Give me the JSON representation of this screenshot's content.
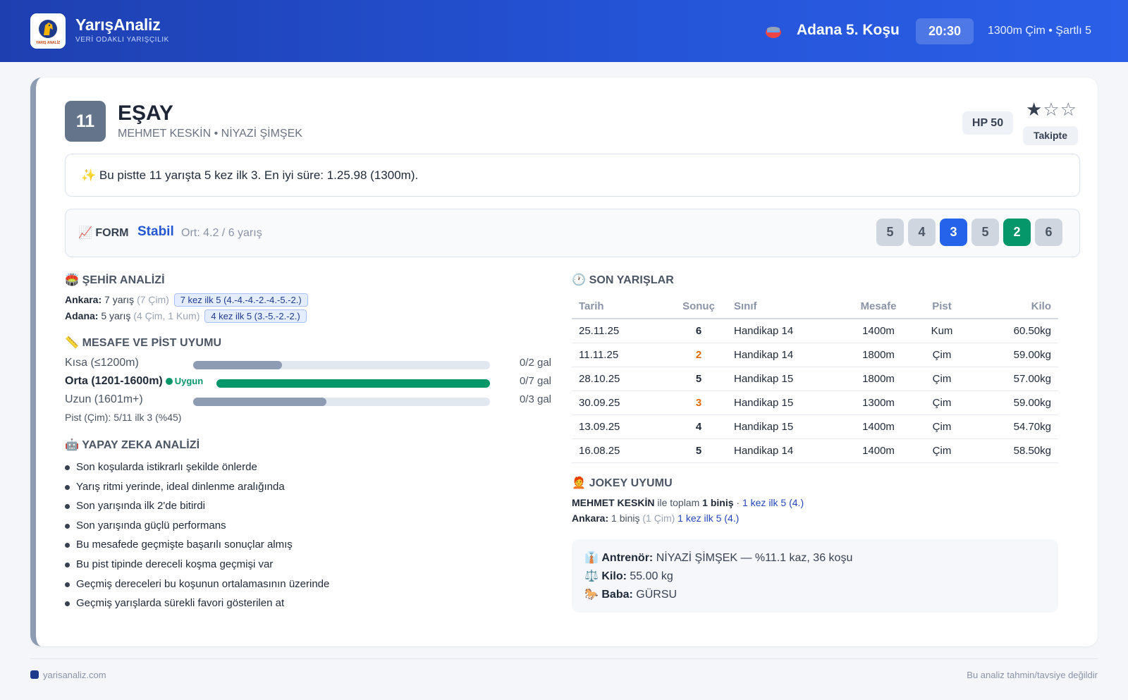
{
  "brand": {
    "name": "YarışAnaliz",
    "tagline": "VERİ ODAKLI YARIŞÇILIK",
    "logo_text": "YARIŞ ANALİZ"
  },
  "race": {
    "title": "Adana 5. Koşu",
    "time": "20:30",
    "info": "1300m Çim • Şartlı 5"
  },
  "horse": {
    "number": "11",
    "name": "EŞAY",
    "people": "MEHMET KESKİN • NİYAZİ ŞİMŞEK",
    "hp": "HP 50",
    "rating": {
      "filled": 1,
      "total": 3,
      "filled_glyph": "★",
      "empty_glyph": "☆"
    },
    "follow_label": "Takipte"
  },
  "insight": {
    "icon": "✨",
    "text": "Bu pistte 11 yarışta 5 kez ilk 3. En iyi süre: 1.25.98 (1300m)."
  },
  "form": {
    "icon": "📈",
    "label": "FORM",
    "status": "Stabil",
    "avg": "Ort: 4.2 / 6 yarış",
    "results": [
      {
        "value": "5",
        "style": "gray"
      },
      {
        "value": "4",
        "style": "gray"
      },
      {
        "value": "3",
        "style": "blue"
      },
      {
        "value": "5",
        "style": "gray"
      },
      {
        "value": "2",
        "style": "green"
      },
      {
        "value": "6",
        "style": "gray"
      }
    ]
  },
  "city": {
    "icon": "🏟️",
    "title": "ŞEHİR ANALİZİ",
    "rows": [
      {
        "city": "Ankara:",
        "count": "7 yarış",
        "detail": "(7 Çim)",
        "tag": "7 kez ilk 5 (4.-4.-4.-2.-4.-5.-2.)"
      },
      {
        "city": "Adana:",
        "count": "5 yarış",
        "detail": "(4 Çim, 1 Kum)",
        "tag": "4 kez ilk 5 (3.-5.-2.-2.)"
      }
    ]
  },
  "distance": {
    "icon": "📏",
    "title": "MESAFE VE PİST UYUMU",
    "rows": [
      {
        "label": "Kısa (≤1200m)",
        "value": "0/2 gal",
        "fill": 0.3,
        "highlight": false,
        "badge": ""
      },
      {
        "label": "Orta (1201-1600m)",
        "value": "0/7 gal",
        "fill": 1.0,
        "highlight": true,
        "badge": "Uygun"
      },
      {
        "label": "Uzun (1601m+)",
        "value": "0/3 gal",
        "fill": 0.45,
        "highlight": false,
        "badge": ""
      }
    ],
    "pist": "Pist (Çim): 5/11 ilk 3 (%45)"
  },
  "ai": {
    "icon": "🤖",
    "title": "YAPAY ZEKA ANALİZİ",
    "items": [
      "Son koşularda istikrarlı şekilde önlerde",
      "Yarış ritmi yerinde, ideal dinlenme aralığında",
      "Son yarışında ilk 2'de bitirdi",
      "Son yarışında güçlü performans",
      "Bu mesafede geçmişte başarılı sonuçlar almış",
      "Bu pist tipinde dereceli koşma geçmişi var",
      "Geçmiş dereceleri bu koşunun ortalamasının üzerinde",
      "Geçmiş yarışlarda sürekli favori gösterilen at"
    ]
  },
  "races": {
    "icon": "🕐",
    "title": "SON YARIŞLAR",
    "headers": [
      "Tarih",
      "Sonuç",
      "Sınıf",
      "Mesafe",
      "Pist",
      "Kilo"
    ],
    "rows": [
      {
        "date": "25.11.25",
        "result": "6",
        "cls": "Handikap 14",
        "dist": "1400m",
        "track": "Kum",
        "kilo": "60.50kg",
        "style": "gray"
      },
      {
        "date": "11.11.25",
        "result": "2",
        "cls": "Handikap 14",
        "dist": "1800m",
        "track": "Çim",
        "kilo": "59.00kg",
        "style": "orange"
      },
      {
        "date": "28.10.25",
        "result": "5",
        "cls": "Handikap 15",
        "dist": "1800m",
        "track": "Çim",
        "kilo": "57.00kg",
        "style": "gray"
      },
      {
        "date": "30.09.25",
        "result": "3",
        "cls": "Handikap 15",
        "dist": "1300m",
        "track": "Çim",
        "kilo": "59.00kg",
        "style": "orange"
      },
      {
        "date": "13.09.25",
        "result": "4",
        "cls": "Handikap 15",
        "dist": "1400m",
        "track": "Çim",
        "kilo": "54.70kg",
        "style": "gray"
      },
      {
        "date": "16.08.25",
        "result": "5",
        "cls": "Handikap 14",
        "dist": "1400m",
        "track": "Çim",
        "kilo": "58.50kg",
        "style": "gray"
      }
    ]
  },
  "jockey": {
    "icon": "🧑‍🦰",
    "title": "JOKEY UYUMU",
    "name": "MEHMET KESKİN",
    "text1": " ile toplam ",
    "rides": "1 biniş",
    "sep": " · ",
    "top5": "1 kez ilk 5 (4.)",
    "city": "Ankara:",
    "city_rides": " 1 biniş ",
    "city_detail": "(1 Çim)",
    "city_top5": " 1 kez ilk 5 (4.)"
  },
  "info": {
    "trainer_icon": "👔",
    "trainer_label": "Antrenör:",
    "trainer_value": " NİYAZİ ŞİMŞEK — %11.1 kaz, 36 koşu",
    "kilo_icon": "⚖️",
    "kilo_label": "Kilo:",
    "kilo_value": " 55.00 kg",
    "sire_icon": "🐎",
    "sire_label": "Baba:",
    "sire_value": " GÜRSU"
  },
  "footer": {
    "site": "yarisanaliz.com",
    "disclaimer": "Bu analiz tahmin/tavsiye değildir"
  },
  "colors": {
    "header": "#2453d6",
    "accent_blue": "#2563eb",
    "accent_green": "#059669",
    "orange": "#e06a00"
  }
}
